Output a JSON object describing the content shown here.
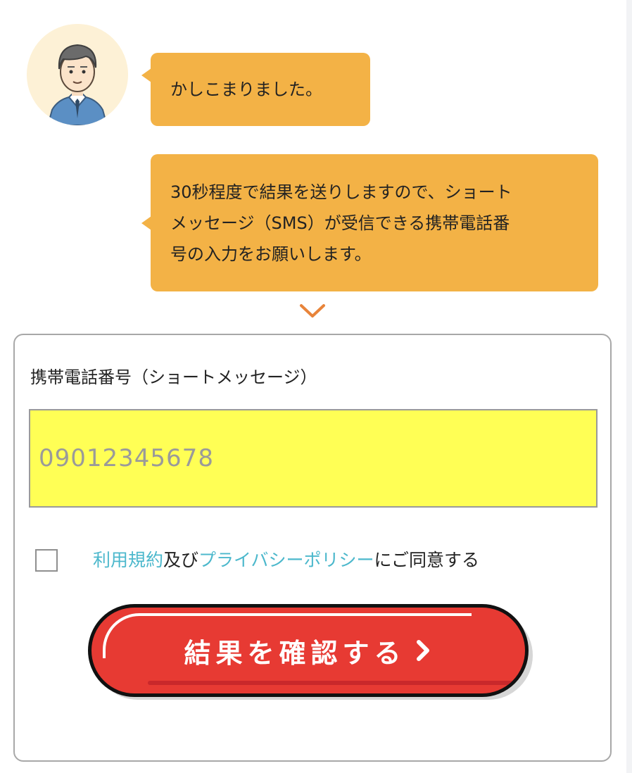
{
  "chat": {
    "message_1": "かしこまりました。",
    "message_2_line_1": "30秒程度で結果を送りしますので、ショート",
    "message_2_line_2": "メッセージ（SMS）が受信できる携帯電話番",
    "message_2_line_3": "号の入力をお願いします。"
  },
  "form": {
    "phone_label": "携帯電話番号（ショートメッセージ）",
    "phone_placeholder": "09012345678",
    "agree_link_terms": "利用規約",
    "agree_and": "及び",
    "agree_link_privacy": "プライバシーポリシー",
    "agree_suffix": "にご同意する",
    "submit_label": "結果を確認する"
  },
  "colors": {
    "bubble": "#f3b246",
    "input_highlight": "#ffff55",
    "link": "#4cb8cc",
    "button": "#e73a33",
    "chevron": "#e8843a"
  },
  "icons": {
    "avatar": "operator-avatar-icon",
    "down": "chevron-down-icon",
    "submit_arrow": "chevron-right-icon"
  }
}
